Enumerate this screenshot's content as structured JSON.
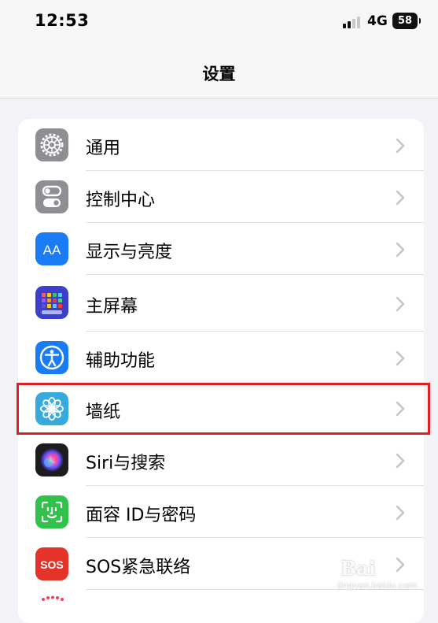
{
  "status_bar": {
    "time": "12:53",
    "network": "4G",
    "battery": "58",
    "signal_bars_on": 2,
    "signal_bars_total": 4
  },
  "nav": {
    "title": "设置"
  },
  "settings_items": [
    {
      "label": "通用",
      "icon": "gear-icon",
      "color": "#8e8e93"
    },
    {
      "label": "控制中心",
      "icon": "toggles-icon",
      "color": "#8e8e93"
    },
    {
      "label": "显示与亮度",
      "icon": "text-size-icon",
      "color": "#1a7cf5"
    },
    {
      "label": "主屏幕",
      "icon": "home-grid-icon",
      "color": "#3b3fc9"
    },
    {
      "label": "辅助功能",
      "icon": "accessibility-icon",
      "color": "#1a7cf5"
    },
    {
      "label": "墙纸",
      "icon": "flower-icon",
      "color": "#36aadc"
    },
    {
      "label": "Siri与搜索",
      "icon": "siri-icon",
      "color": "#1c1c1e"
    },
    {
      "label": "面容 ID与密码",
      "icon": "face-id-icon",
      "color": "#30c24a"
    },
    {
      "label": "SOS紧急联络",
      "icon": "sos-icon",
      "color": "#e5332a"
    }
  ],
  "highlighted_item": "墙纸",
  "watermark": {
    "main": "Bai",
    "sub": "jingyan.baidu.com"
  }
}
